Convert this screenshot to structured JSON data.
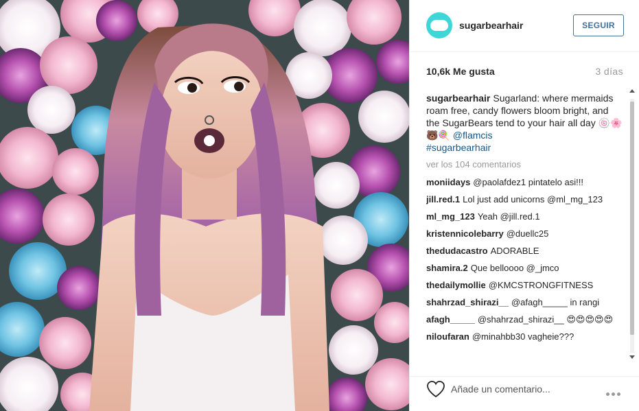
{
  "header": {
    "username": "sugarbearhair",
    "follow_label": "SEGUIR"
  },
  "stats": {
    "likes": "10,6k Me gusta",
    "time_ago": "3 días"
  },
  "caption": {
    "user": "sugarbearhair",
    "text": "Sugarland: where mermaids roam free, candy flowers bloom bright, and the SugarBears tend to your hair all day 🍥🌸🐻🍭",
    "mention": "@flamcis",
    "hashtag": "#sugarbearhair"
  },
  "view_all": "ver los 104 comentarios",
  "comments": [
    {
      "user": "moniidays",
      "text": "@paolafdez1 pintatelo asi!!!"
    },
    {
      "user": "jill.red.1",
      "text": "Lol just add unicorns @ml_mg_123"
    },
    {
      "user": "ml_mg_123",
      "text": "Yeah @jill.red.1"
    },
    {
      "user": "kristennicolebarry",
      "text": "@duellc25"
    },
    {
      "user": "thedudacastro",
      "text": "ADORABLE"
    },
    {
      "user": "shamira.2",
      "text": "Que belloooo @_jmco"
    },
    {
      "user": "thedailymollie",
      "text": "@KMCSTRONGFITNESS"
    },
    {
      "user": "shahrzad_shirazi__",
      "text": "@afagh_____ in rangi"
    },
    {
      "user": "afagh_____",
      "text": "@shahrzad_shirazi__ 😍😍😍😍😍"
    },
    {
      "user": "niloufaran",
      "text": "@minahbb30 vagheie???"
    }
  ],
  "footer": {
    "comment_placeholder": "Añade un comentario..."
  },
  "icons": {
    "avatar": "sugarbear-logo-icon",
    "like": "heart-icon",
    "more": "more-options-icon"
  },
  "colors": {
    "accent": "#3f729b",
    "link": "#125688",
    "avatar_bg": "#3ed6d6",
    "muted": "#999999"
  }
}
